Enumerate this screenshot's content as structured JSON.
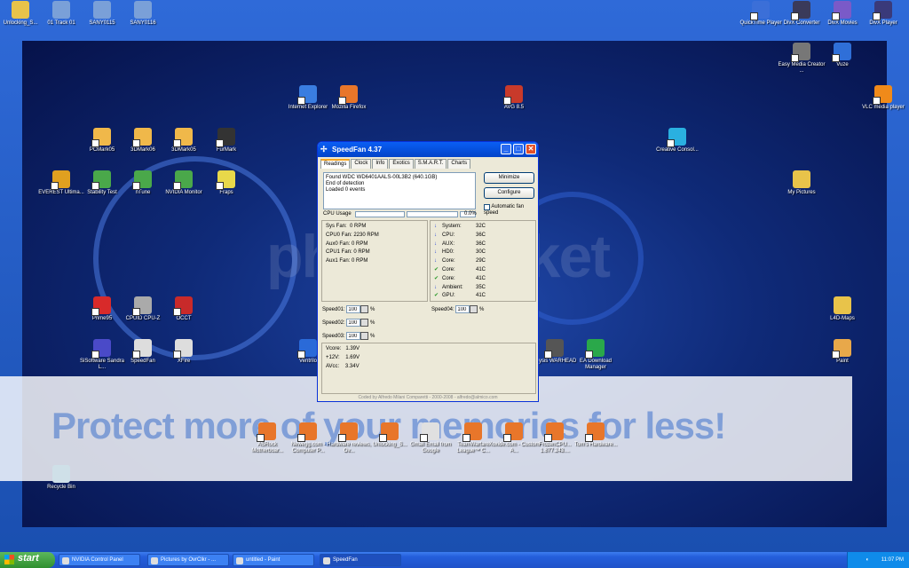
{
  "desktop_icons": [
    {
      "id": "unlocking1",
      "label": "Unlocking_S...",
      "color": "#e8c34a"
    },
    {
      "id": "track01",
      "label": "01 Track 01",
      "color": "#7aa0d8"
    },
    {
      "id": "sany0115",
      "label": "SANY0115",
      "color": "#7aa0d8"
    },
    {
      "id": "sany0116",
      "label": "SANY0116",
      "color": "#7aa0d8"
    },
    {
      "id": "quicktime",
      "label": "QuickTime Player",
      "color": "#3b6fd8"
    },
    {
      "id": "divxconv",
      "label": "DivX Converter",
      "color": "#3a3a5a"
    },
    {
      "id": "divxmovies",
      "label": "DivX Movies",
      "color": "#7a5ac8"
    },
    {
      "id": "divxplayer",
      "label": "DivX Player",
      "color": "#3a3a7a"
    },
    {
      "id": "easymedia",
      "label": "Easy Media Creator ...",
      "color": "#777"
    },
    {
      "id": "vuze",
      "label": "Vuze",
      "color": "#2f6fd8"
    },
    {
      "id": "vlc",
      "label": "VLC media player",
      "color": "#f08a1a"
    },
    {
      "id": "ie",
      "label": "Internet Explorer",
      "color": "#3a7de0"
    },
    {
      "id": "firefox",
      "label": "Mozilla Firefox",
      "color": "#e8762a"
    },
    {
      "id": "avg",
      "label": "AVG 8.5",
      "color": "#c83a2a"
    },
    {
      "id": "pcmark",
      "label": "PCMark05",
      "color": "#f0b84a"
    },
    {
      "id": "3dmark06",
      "label": "3DMark06",
      "color": "#f0b84a"
    },
    {
      "id": "3dmark05",
      "label": "3DMark05",
      "color": "#f0b84a"
    },
    {
      "id": "furmark",
      "label": "FurMark",
      "color": "#333"
    },
    {
      "id": "creative",
      "label": "Creative Consol...",
      "color": "#2ab0e0"
    },
    {
      "id": "everest",
      "label": "EVEREST Ultima...",
      "color": "#e0a020"
    },
    {
      "id": "stability",
      "label": "Stability Test",
      "color": "#4aa84a"
    },
    {
      "id": "ntune",
      "label": "nTune",
      "color": "#4aa84a"
    },
    {
      "id": "nvmonitor",
      "label": "NVIDIA Monitor",
      "color": "#4aa84a"
    },
    {
      "id": "fraps",
      "label": "Fraps",
      "color": "#e8d84a"
    },
    {
      "id": "mypictures",
      "label": "My Pictures",
      "color": "#e8c34a"
    },
    {
      "id": "prime95",
      "label": "Prime95",
      "color": "#d82a2a"
    },
    {
      "id": "cpuz",
      "label": "CPUID CPU-Z",
      "color": "#aaa"
    },
    {
      "id": "occt",
      "label": "OCCT",
      "color": "#c82a2a"
    },
    {
      "id": "l4d",
      "label": "L4D-Maps",
      "color": "#e8c34a"
    },
    {
      "id": "sisoft",
      "label": "SiSoftware Sandra L...",
      "color": "#4a4ac8"
    },
    {
      "id": "speedfan",
      "label": "SpeedFan",
      "color": "#ddd"
    },
    {
      "id": "xfire",
      "label": "XFire",
      "color": "#ddd"
    },
    {
      "id": "ventrilo",
      "label": "Ventrilo",
      "color": "#2a6ad8"
    },
    {
      "id": "crysis",
      "label": "Crysis WARHEAD",
      "color": "#555"
    },
    {
      "id": "eadownload",
      "label": "EA Download Manager",
      "color": "#2aa84a"
    },
    {
      "id": "paint",
      "label": "Paint",
      "color": "#e8a84a"
    },
    {
      "id": "asrock",
      "label": "ASRock Motherboar...",
      "color": "#e8762a"
    },
    {
      "id": "newegg",
      "label": "Newegg.com - Computer P...",
      "color": "#e8762a"
    },
    {
      "id": "hardware",
      "label": "Hardware reviews, Ov...",
      "color": "#e8762a"
    },
    {
      "id": "unlocking2",
      "label": "Unlocking_S...",
      "color": "#e8762a"
    },
    {
      "id": "gmail",
      "label": "Gmail Email from Google",
      "color": "#e0e0e0"
    },
    {
      "id": "teamwarfare",
      "label": "TeamWarfare League™ C...",
      "color": "#e8762a"
    },
    {
      "id": "xoxide",
      "label": "Xoxide.com - Custom A...",
      "color": "#e8762a"
    },
    {
      "id": "frozencpu",
      "label": "FrozenCPU... 1.877.243....",
      "color": "#e8762a"
    },
    {
      "id": "toms",
      "label": "Tom's Hardware...",
      "color": "#e8762a"
    },
    {
      "id": "recycle",
      "label": "Recycle Bin",
      "color": "#cfe0e8"
    }
  ],
  "watermark": {
    "banner": "Protect more of your memories for less!",
    "logo": "photobucket"
  },
  "speedfan": {
    "title": "SpeedFan 4.37",
    "tabs": [
      "Readings",
      "Clock",
      "Info",
      "Exotics",
      "S.M.A.R.T.",
      "Charts"
    ],
    "log": [
      "Found WDC WD6401AALS-00L3B2 (640.1GB)",
      "End of detection",
      "Loaded 0 events"
    ],
    "minimize": "Minimize",
    "configure": "Configure",
    "auto_fan": "Automatic fan speed",
    "cpu_usage_label": "CPU Usage",
    "cpu_usage_value": "0.0%",
    "fans": [
      "Sys Fan:  0 RPM",
      "CPU0 Fan: 2230 RPM",
      "Aux0 Fan: 0 RPM",
      "CPU1 Fan: 0 RPM",
      "Aux1 Fan: 0 RPM"
    ],
    "temps": [
      {
        "arrow": "↓",
        "name": "System:",
        "value": "32C",
        "color": "#1a3ad8"
      },
      {
        "arrow": "↓",
        "name": "CPU:",
        "value": "36C",
        "color": "#1a3ad8"
      },
      {
        "arrow": "↓",
        "name": "AUX:",
        "value": "36C",
        "color": "#1a3ad8"
      },
      {
        "arrow": "↓",
        "name": "HD0:",
        "value": "30C",
        "color": "#1a3ad8"
      },
      {
        "arrow": "↓",
        "name": "Core:",
        "value": "29C",
        "color": "#1a3ad8"
      },
      {
        "arrow": "✔",
        "name": "Core:",
        "value": "41C",
        "color": "#2a9a2a"
      },
      {
        "arrow": "✔",
        "name": "Core:",
        "value": "41C",
        "color": "#2a9a2a"
      },
      {
        "arrow": "↓",
        "name": "Ambient:",
        "value": "35C",
        "color": "#1a3ad8"
      },
      {
        "arrow": "✔",
        "name": "GPU:",
        "value": "41C",
        "color": "#2a9a2a"
      }
    ],
    "speeds": [
      {
        "label": "Speed01:",
        "value": "100",
        "unit": "%"
      },
      {
        "label": "Speed02:",
        "value": "100",
        "unit": "%"
      },
      {
        "label": "Speed03:",
        "value": "100",
        "unit": "%"
      },
      {
        "label": "Speed04:",
        "value": "100",
        "unit": "%"
      }
    ],
    "volts": [
      "Vcore:   1.39V",
      "+12V:    1.69V",
      "AVcc:    3.34V"
    ],
    "footer": "Coded by Alfredo Milani Comparetti - 2000-2008 - alfredo@almico.com"
  },
  "taskbar": {
    "start": "start",
    "items": [
      "NVIDIA Control Panel",
      "Pictures by OvrClkr - ...",
      "untitled - Paint",
      "SpeedFan"
    ],
    "clock": "11:07 PM"
  }
}
